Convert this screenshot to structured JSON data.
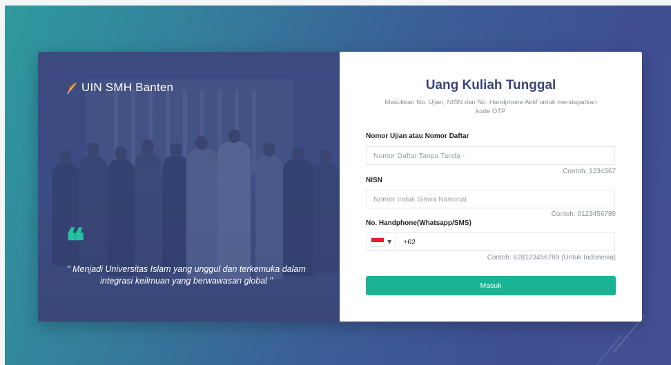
{
  "brand": {
    "name": "UIN SMH Banten",
    "logo_icon": "feather-logo-icon"
  },
  "quote": {
    "icon": "quote-icon",
    "text": "\" Menjadi Universitas Islam yang unggul dan terkemuka dalam integrasi keilmuan yang berwawasan global \""
  },
  "form": {
    "title": "Uang Kuliah Tunggal",
    "subtitle": "Masukkan No. Ujian, NISN dan No. Handphone Aktif untuk mendapatkan kode OTP",
    "exam": {
      "label": "Nomor Ujian atau Nomor Daftar",
      "placeholder": "Nomor Daftar Tanpa Tanda -",
      "value": "",
      "hint": "Contoh: 1234567"
    },
    "nisn": {
      "label": "NISN",
      "placeholder": "Nomor Induk Siswa Nasional",
      "value": "",
      "hint": "Contoh: 0123456789"
    },
    "phone": {
      "label": "No. Handphone(Whatsapp/SMS)",
      "country_flag": "indonesia-flag-icon",
      "value": "+62",
      "hint": "Contoh: 628123456789 (Untuk Indonesia)"
    },
    "submit_label": "Masuk"
  },
  "colors": {
    "accent": "#1ab393",
    "title": "#3a4479",
    "quote": "#26c2a0",
    "panel": "#3d4a80"
  }
}
